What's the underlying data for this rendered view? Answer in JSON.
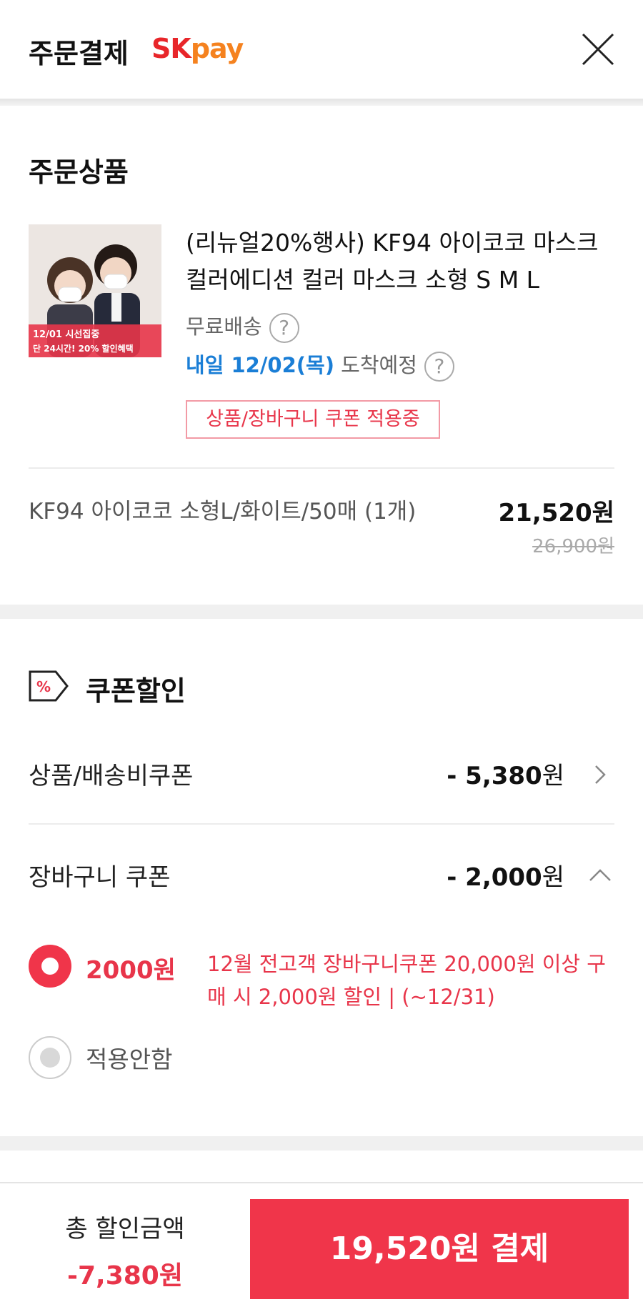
{
  "header": {
    "title": "주문결제",
    "logo_sk": "SK",
    "logo_pay": "pay"
  },
  "order_section": {
    "title": "주문상품",
    "product": {
      "image_banner_line1": "12/01 시선집중",
      "image_banner_line2": "단 24시간! 20% 할인혜택",
      "name": "(리뉴얼20%행사) KF94 아이코코 마스크 컬러에디션 컬러 마스크 소형 S M L",
      "shipping": "무료배송",
      "arrival_date": "내일 12/02(목)",
      "arrival_suffix": "도착예정",
      "coupon_tag": "상품/장바구니 쿠폰 적용중",
      "option": "KF94 아이코코 소형L/화이트/50매 (1개)",
      "price": "21,520원",
      "original_price": "26,900원"
    }
  },
  "coupon_section": {
    "title": "쿠폰할인",
    "icon_text": "%",
    "rows": [
      {
        "label": "상품/배송비쿠폰",
        "amount": "- 5,380",
        "unit": "원"
      },
      {
        "label": "장바구니 쿠폰",
        "amount": "- 2,000",
        "unit": "원"
      }
    ],
    "options": [
      {
        "amount": "2000원",
        "desc": "12월 전고객 장바구니쿠폰 20,000원 이상 구매 시 2,000원 할인 | (~12/31)"
      },
      {
        "label": "적용안함"
      }
    ]
  },
  "bottom": {
    "total_label": "총 할인금액",
    "total_value": "-7,380원",
    "pay_button": "19,520원 결제"
  },
  "colors": {
    "accent": "#f0354a",
    "link_blue": "#1a7ed6",
    "sk_red": "#e8262a",
    "pay_orange": "#f5821f"
  }
}
